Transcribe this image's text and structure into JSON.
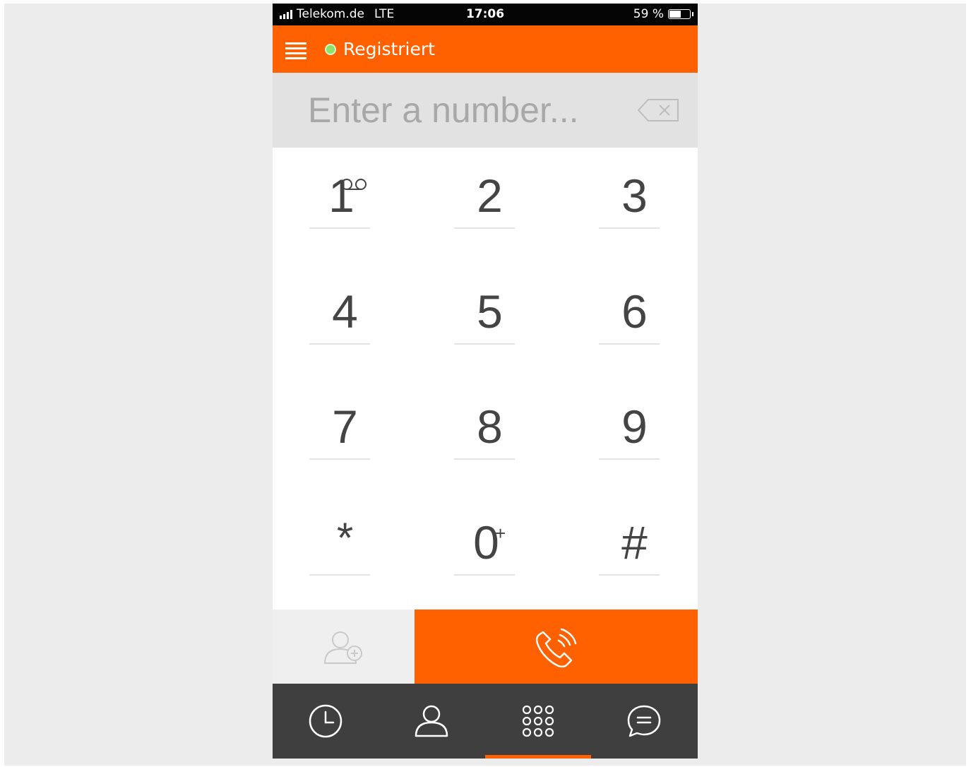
{
  "status_bar": {
    "carrier": "Telekom.de",
    "network": "LTE",
    "time": "17:06",
    "battery_text": "59 %",
    "battery_level": 0.59
  },
  "header": {
    "status_label": "Registriert"
  },
  "dialer": {
    "placeholder": "Enter a number..."
  },
  "keypad": {
    "keys": [
      {
        "digit": "1",
        "sub": ""
      },
      {
        "digit": "2",
        "sub": ""
      },
      {
        "digit": "3",
        "sub": ""
      },
      {
        "digit": "4",
        "sub": ""
      },
      {
        "digit": "5",
        "sub": ""
      },
      {
        "digit": "6",
        "sub": ""
      },
      {
        "digit": "7",
        "sub": ""
      },
      {
        "digit": "8",
        "sub": ""
      },
      {
        "digit": "9",
        "sub": ""
      },
      {
        "digit": "*",
        "sub": ""
      },
      {
        "digit": "0",
        "sub": "+"
      },
      {
        "digit": "#",
        "sub": ""
      }
    ]
  },
  "icons": {
    "menu": "menu-icon",
    "backspace": "backspace-icon",
    "voicemail": "voicemail-icon",
    "add_contact": "add-contact-icon",
    "call": "phone-call-icon",
    "recents": "clock-icon",
    "contacts": "person-icon",
    "keypad": "keypad-grid-icon",
    "messages": "chat-bubble-icon"
  },
  "colors": {
    "accent": "#ff6000",
    "status_ok": "#8be36a",
    "tabbar": "#3f3f3f"
  },
  "tabs": {
    "active_index": 2
  }
}
